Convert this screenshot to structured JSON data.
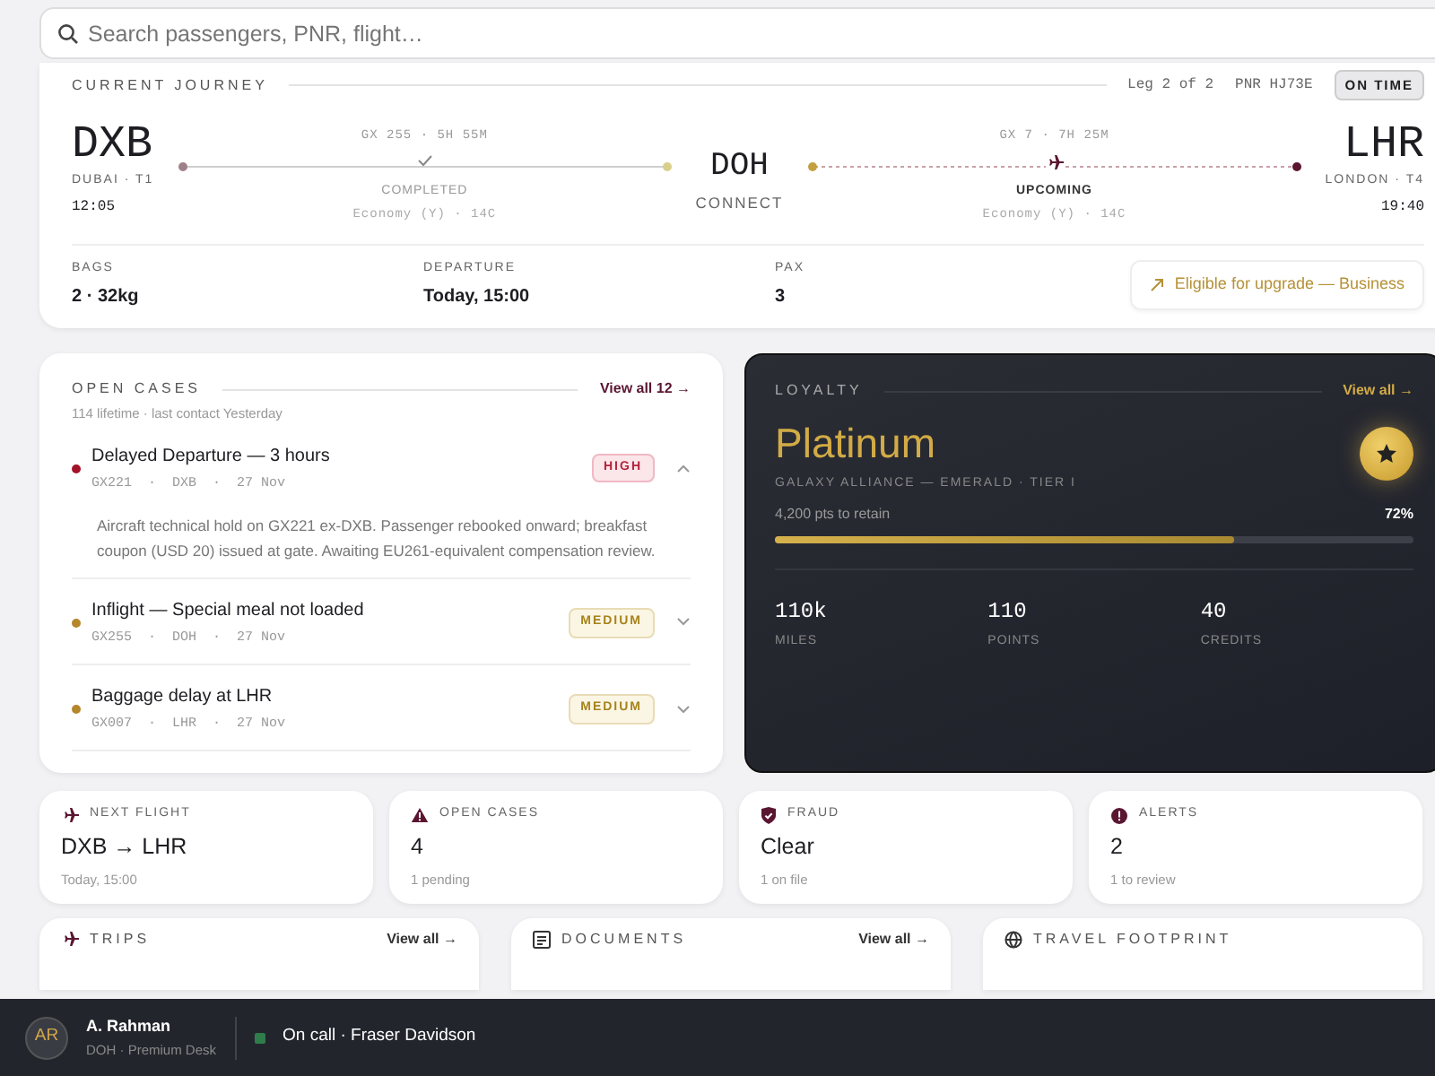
{
  "search": {
    "placeholder": "Search passengers, PNR, flight…"
  },
  "journey": {
    "title": "CURRENT JOURNEY",
    "leg": "Leg 2 of 2",
    "pnr": "PNR HJ73E",
    "status": "ON TIME",
    "origin": {
      "code": "DXB",
      "place": "DUBAI · T1",
      "time": "12:05"
    },
    "connection": {
      "code": "DOH",
      "label": "CONNECT"
    },
    "destination": {
      "code": "LHR",
      "place": "LONDON · T4",
      "time": "19:40"
    },
    "legs": [
      {
        "kind": "completed",
        "flight": "GX 255 · 5H 55M",
        "status": "COMPLETED",
        "cabin": "Economy (Y) · 14C"
      },
      {
        "kind": "upcoming",
        "flight": "GX 7 · 7H 25M",
        "status": "UPCOMING",
        "cabin": "Economy (Y) · 14C"
      }
    ],
    "details": [
      {
        "label": "BAGS",
        "value": "2 · 32kg"
      },
      {
        "label": "DEPARTURE",
        "value": "Today, 15:00"
      },
      {
        "label": "PAX",
        "value": "3"
      }
    ],
    "upgrade": "Eligible for upgrade — Business"
  },
  "cases": {
    "title": "OPEN CASES",
    "link": "View all 12 →",
    "subtitle": "114 lifetime · last contact Yesterday",
    "items": [
      {
        "title": "Delayed Departure — 3 hours",
        "meta": "GX221  ·  DXB  ·  27 Nov",
        "severity": "HIGH",
        "kind": "high",
        "color": "#a3122a",
        "expanded": true,
        "description": "Aircraft technical hold on GX221 ex-DXB. Passenger rebooked onward; breakfast coupon (USD 20) issued at gate. Awaiting EU261-equivalent compensation review."
      },
      {
        "title": "Inflight — Special meal not loaded",
        "meta": "GX255  ·  DOH  ·  27 Nov",
        "severity": "MEDIUM",
        "kind": "medium",
        "color": "#b5862a",
        "expanded": false
      },
      {
        "title": "Baggage delay at LHR",
        "meta": "GX007  ·  LHR  ·  27 Nov",
        "severity": "MEDIUM",
        "kind": "medium",
        "color": "#b5862a",
        "expanded": false
      }
    ]
  },
  "loyalty": {
    "title": "LOYALTY",
    "link": "View all →",
    "tier": "Platinum",
    "program": "GALAXY ALLIANCE — EMERALD · TIER I",
    "progress_label": "4,200 pts to retain",
    "percent": "72%",
    "level": 0.72,
    "stats": [
      {
        "value": "110k",
        "label": "MILES"
      },
      {
        "value": "110",
        "label": "POINTS"
      },
      {
        "value": "40",
        "label": "CREDITS"
      }
    ]
  },
  "summary": [
    {
      "kind": "plane",
      "label": "NEXT FLIGHT",
      "value": "DXB → LHR",
      "sub": "Today, 15:00"
    },
    {
      "kind": "warning",
      "label": "OPEN CASES",
      "value": "4",
      "sub": "1 pending"
    },
    {
      "kind": "shield",
      "label": "FRAUD",
      "value": "Clear",
      "sub": "1 on file"
    },
    {
      "kind": "alert",
      "label": "ALERTS",
      "value": "2",
      "sub": "1 to review"
    }
  ],
  "sections": [
    {
      "kind": "plane",
      "title": "TRIPS",
      "link": "View all →"
    },
    {
      "kind": "doc",
      "title": "DOCUMENTS",
      "link": "View all →"
    },
    {
      "kind": "globe",
      "title": "TRAVEL FOOTPRINT"
    }
  ],
  "footer": {
    "initials": "AR",
    "name": "A. Rahman",
    "role": "DOH · Premium Desk",
    "status": "On call · Fraser Davidson",
    "color": "#2e7d4a"
  }
}
